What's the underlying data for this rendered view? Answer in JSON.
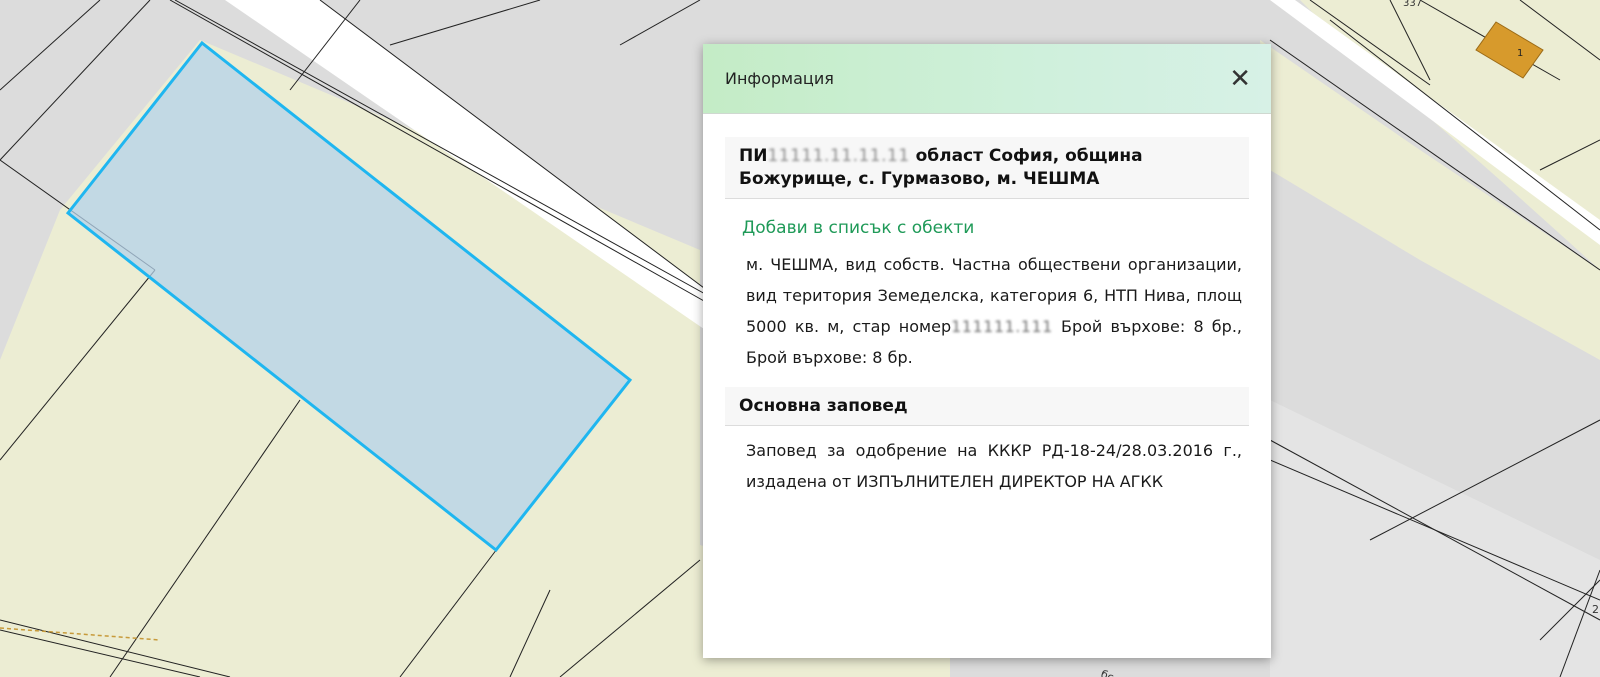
{
  "map": {
    "parcel_labels": [
      "337",
      "1",
      "2",
      "бс"
    ],
    "colors": {
      "field": "#ecedd3",
      "gray_area": "#dcdcdc",
      "road": "#ffffff",
      "parcel_outline": "#1fb6f0",
      "building": "#d79a2c"
    }
  },
  "popup": {
    "title": "Информация",
    "close_icon": "close-icon",
    "parcel": {
      "prefix": "ПИ",
      "redacted_id": "11111.11.11.11",
      "location": " област София, община Божурище, с. Гурмазово, м. ЧЕШМА"
    },
    "add_link": "Добави в списък с обекти",
    "description": {
      "part1": "м. ЧЕШМА, вид собств. Частна обществени организации, вид територия Земеделска, категория 6, НТП Нива, площ 5000 кв. м, стар номер",
      "redacted_old_number": "111111.111",
      "part2": " Брой върхове: 8 бр., Брой върхове: 8 бр."
    },
    "order_heading": "Основна заповед",
    "order_text": "Заповед за одобрение на КККР РД-18-24/28.03.2016 г., издадена от ИЗПЪЛНИТЕЛЕН ДИРЕКТОР НА АГКК"
  }
}
